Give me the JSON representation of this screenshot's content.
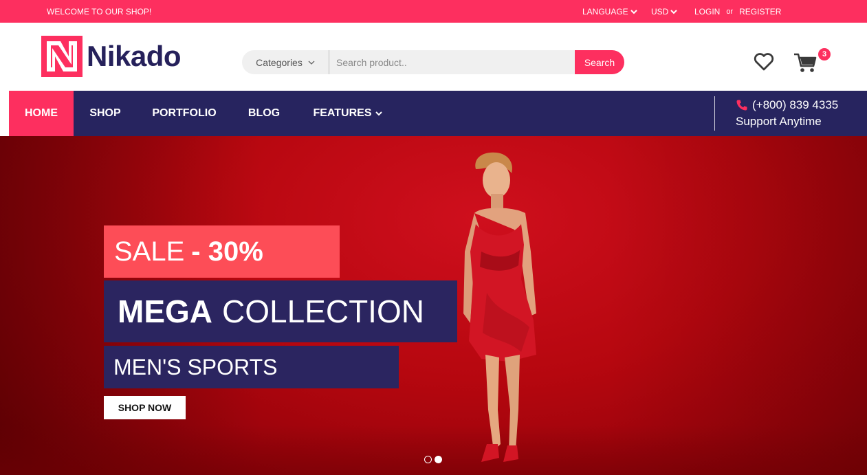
{
  "topbar": {
    "welcome": "WELCOME TO OUR SHOP!",
    "language": "LANGUAGE",
    "currency": "USD",
    "login": "LOGIN",
    "or": "or",
    "register": "REGISTER"
  },
  "header": {
    "logo_text": "Nikado",
    "search": {
      "category_label": "Categories",
      "placeholder": "Search product..",
      "button_label": "Search"
    },
    "cart_count": "3"
  },
  "nav": {
    "items": [
      {
        "label": "HOME"
      },
      {
        "label": "SHOP"
      },
      {
        "label": "PORTFOLIO"
      },
      {
        "label": "BLOG"
      },
      {
        "label": "FEATURES"
      }
    ],
    "active_index": 0,
    "phone": "(+800) 839 4335",
    "support": "Support Anytime"
  },
  "hero": {
    "sale_prefix": "SALE",
    "sale_value": "- 30%",
    "mega_bold": "MEGA",
    "mega_rest": "COLLECTION",
    "subtitle": "MEN'S SPORTS",
    "cta": "SHOP NOW",
    "slides": 2,
    "active_slide": 2
  },
  "colors": {
    "brand_pink": "#fd2f5f",
    "navy": "#27245f",
    "hero_red": "#b6070f",
    "sale_coral": "#fd4d57"
  },
  "icons": [
    "chevron-down-icon",
    "logo-icon",
    "heart-icon",
    "cart-icon",
    "phone-icon"
  ]
}
